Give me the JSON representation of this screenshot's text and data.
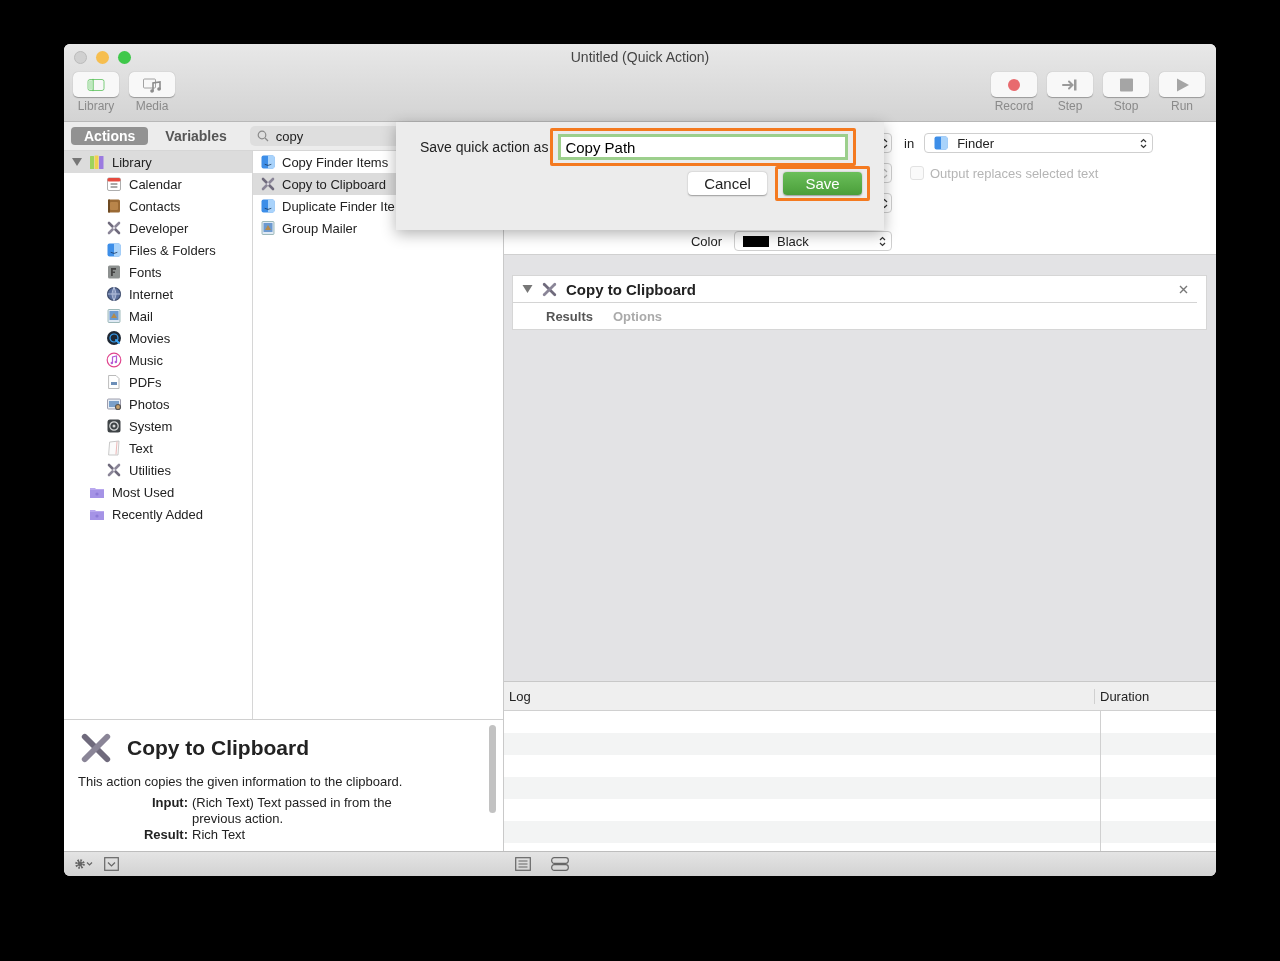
{
  "window": {
    "title": "Untitled (Quick Action)"
  },
  "toolbar": {
    "left": [
      {
        "label": "Library"
      },
      {
        "label": "Media"
      }
    ],
    "right": [
      {
        "label": "Record"
      },
      {
        "label": "Step"
      },
      {
        "label": "Stop"
      },
      {
        "label": "Run"
      }
    ]
  },
  "library_tabs": [
    {
      "label": "Actions",
      "selected": true
    },
    {
      "label": "Variables",
      "selected": false
    }
  ],
  "search": {
    "value": "copy"
  },
  "library": [
    {
      "label": "Library",
      "expanded": true,
      "selected": true,
      "children": [
        {
          "label": "Calendar",
          "selected": false
        },
        {
          "label": "Contacts",
          "selected": false
        },
        {
          "label": "Developer",
          "selected": false
        },
        {
          "label": "Files & Folders",
          "selected": false
        },
        {
          "label": "Fonts",
          "selected": false
        },
        {
          "label": "Internet",
          "selected": false
        },
        {
          "label": "Mail",
          "selected": false
        },
        {
          "label": "Movies",
          "selected": false
        },
        {
          "label": "Music",
          "selected": false
        },
        {
          "label": "PDFs",
          "selected": false
        },
        {
          "label": "Photos",
          "selected": false
        },
        {
          "label": "System",
          "selected": false
        },
        {
          "label": "Text",
          "selected": false
        },
        {
          "label": "Utilities",
          "selected": false
        }
      ]
    },
    {
      "label": "Most Used",
      "selected": false
    },
    {
      "label": "Recently Added",
      "selected": false
    }
  ],
  "results": [
    {
      "label": "Copy Finder Items",
      "selected": false
    },
    {
      "label": "Copy to Clipboard",
      "selected": true
    },
    {
      "label": "Duplicate Finder Ite",
      "selected": false
    },
    {
      "label": "Group Mailer",
      "selected": false
    }
  ],
  "description": {
    "title": "Copy to Clipboard",
    "text": "This action copies the given information to the clipboard.",
    "fields": [
      {
        "label": "Input:",
        "value": "(Rich Text) Text passed in from the previous action."
      },
      {
        "label": "Result:",
        "value": "Rich Text"
      }
    ]
  },
  "workflow_header": {
    "in_label": "in",
    "application": "Finder",
    "output_replaces": {
      "label": "Output replaces selected text",
      "checked": false,
      "disabled": true
    },
    "color_label": "Color",
    "color_value": "Black"
  },
  "dialog": {
    "label": "Save quick action as",
    "name_field": {
      "value": "Copy Path",
      "highlighted": true
    },
    "buttons": [
      {
        "label": "Cancel",
        "default": false,
        "highlighted": false
      },
      {
        "label": "Save",
        "default": true,
        "highlighted": true
      }
    ]
  },
  "action_card": {
    "title": "Copy to Clipboard",
    "expanded": true,
    "tabs": [
      {
        "label": "Results",
        "selected": true
      },
      {
        "label": "Options",
        "selected": false
      }
    ]
  },
  "log": {
    "columns": [
      "Log",
      "Duration"
    ]
  }
}
